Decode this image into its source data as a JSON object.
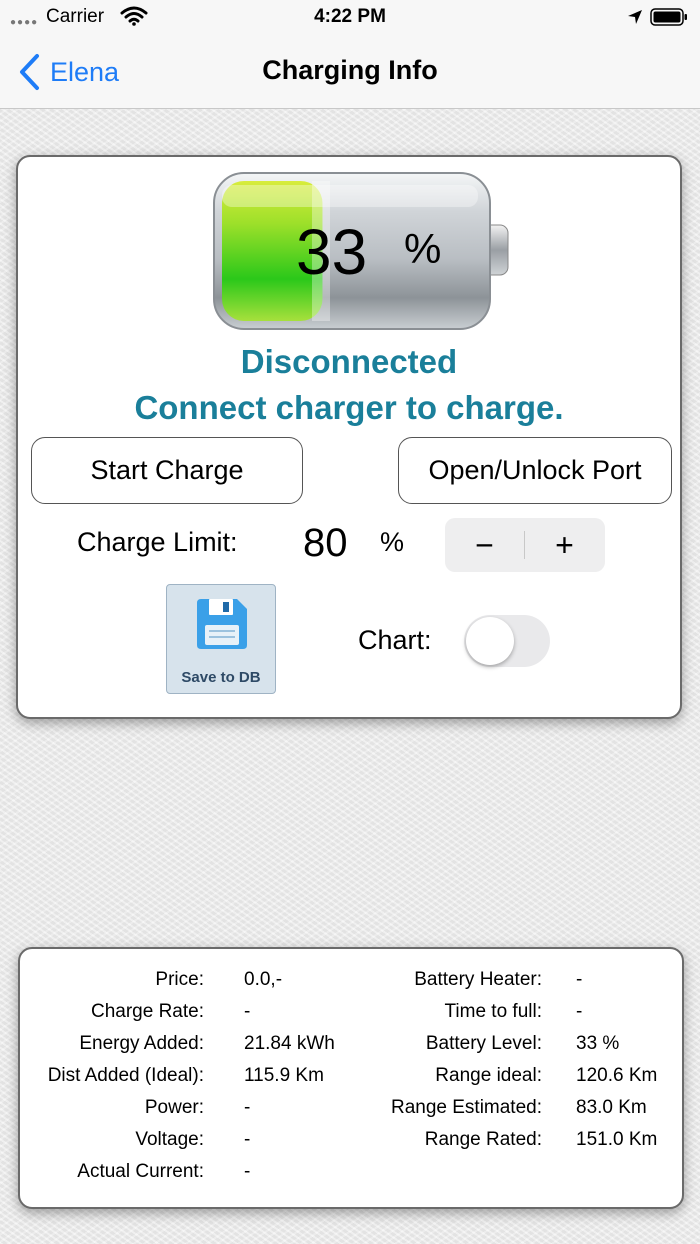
{
  "status_bar": {
    "carrier": "Carrier",
    "time": "4:22 PM"
  },
  "nav": {
    "back_label": "Elena",
    "title": "Charging Info"
  },
  "battery": {
    "percent": "33",
    "unit": "%"
  },
  "status": {
    "line1": "Disconnected",
    "line2": "Connect charger to charge."
  },
  "buttons": {
    "start_charge": "Start Charge",
    "open_port": "Open/Unlock Port",
    "save_label": "Save to DB"
  },
  "charge_limit": {
    "label": "Charge Limit:",
    "value": "80",
    "unit": "%",
    "minus": "−",
    "plus": "+"
  },
  "chart": {
    "label": "Chart:",
    "enabled": false
  },
  "info_left": [
    {
      "label": "Price:",
      "value": "0.0,-"
    },
    {
      "label": "Charge Rate:",
      "value": "-"
    },
    {
      "label": "Energy Added:",
      "value": "21.84 kWh"
    },
    {
      "label": "Dist Added (Ideal):",
      "value": "115.9 Km"
    },
    {
      "label": "Power:",
      "value": "-"
    },
    {
      "label": "Voltage:",
      "value": "-"
    },
    {
      "label": "Actual Current:",
      "value": "-"
    }
  ],
  "info_right": [
    {
      "label": "Battery Heater:",
      "value": "-"
    },
    {
      "label": "Time to full:",
      "value": "-"
    },
    {
      "label": "Battery Level:",
      "value": "33 %"
    },
    {
      "label": "Range ideal:",
      "value": "120.6 Km"
    },
    {
      "label": "Range  Estimated:",
      "value": "83.0 Km"
    },
    {
      "label": "Range Rated:",
      "value": "151.0 Km"
    }
  ],
  "colors": {
    "accent": "#1e7cf7",
    "status_text": "#1a7f9a",
    "battery_green": "#3bc81a"
  }
}
